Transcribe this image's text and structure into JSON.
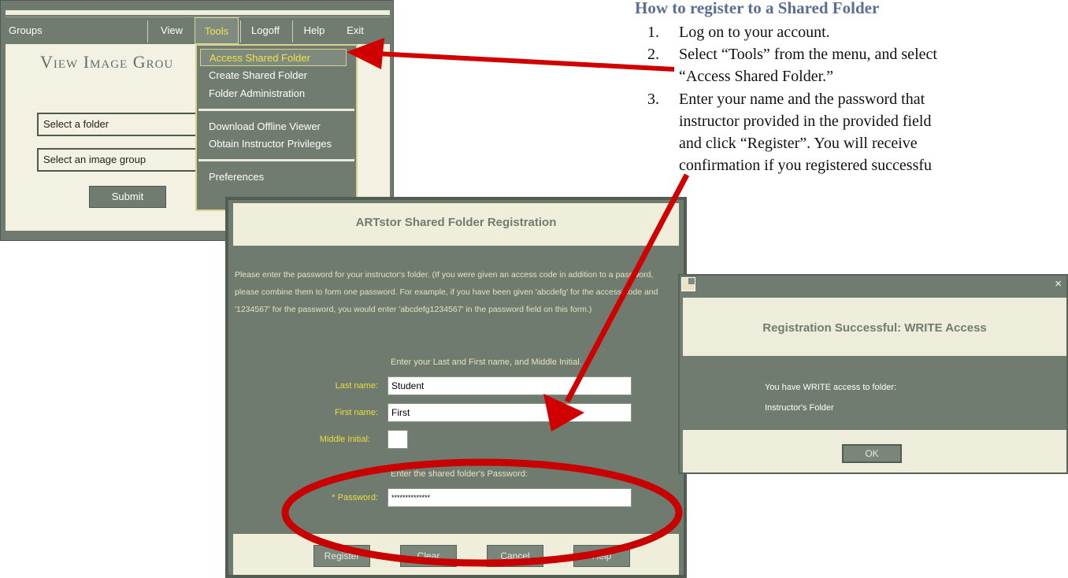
{
  "instructions": {
    "title": "How to register to a Shared Folder",
    "steps": [
      {
        "num": "1.",
        "lines": [
          "Log on to your account."
        ]
      },
      {
        "num": "2.",
        "lines": [
          "Select “Tools” from the menu, and select",
          "“Access Shared Folder.”"
        ]
      },
      {
        "num": "3.",
        "lines": [
          "Enter your name and the password that",
          "instructor provided in the provided field",
          "and click “Register”.  You will receive",
          "confirmation if you registered successfu"
        ]
      }
    ]
  },
  "main_window": {
    "menu": {
      "groups": "Groups",
      "view": "View",
      "tools": "Tools",
      "logoff": "Logoff",
      "help": "Help",
      "exit": "Exit"
    },
    "heading": "View Image Grou",
    "folder_select": "Select a folder",
    "group_select": "Select an image group",
    "submit": "Submit"
  },
  "tools_menu": {
    "items": [
      "Access Shared Folder",
      "Create Shared Folder",
      "Folder Administration",
      "Download Offline Viewer",
      "Obtain Instructor Privileges",
      "Preferences"
    ],
    "highlighted_index": 0
  },
  "registration": {
    "title": "ARTstor Shared Folder Registration",
    "intro": "Please enter the password for your instructor's folder. (If you were given an access code in addition to a password, please combine them to form one password. For example, if you have been given 'abcdefg' for the access code and '1234567' for the password, you would enter 'abcdefg1234567' in the password field on this form.)",
    "name_instruction": "Enter your Last and First name, and Middle Initial.",
    "last_name_label": "Last name:",
    "last_name_value": "Student",
    "first_name_label": "First name:",
    "first_name_value": "First",
    "middle_label": "Middle Initial:",
    "middle_value": "",
    "password_instruction": "Enter the shared folder's Password:",
    "password_label": "* Password:",
    "password_value": "**************",
    "buttons": {
      "register": "Register",
      "clear": "Clear",
      "cancel": "Cancel",
      "help": "Help"
    }
  },
  "success_dialog": {
    "title": "Registration Successful: WRITE Access",
    "message_line1": "You have WRITE access to folder:",
    "message_line2": "Instructor's Folder",
    "ok": "OK",
    "close_glyph": "×"
  },
  "colors": {
    "panel_green": "#6e7b6e",
    "cream": "#efeedb",
    "label_yellow": "#f0dd3d",
    "arrow_red": "#d00000",
    "title_blue": "#5a6e93"
  }
}
